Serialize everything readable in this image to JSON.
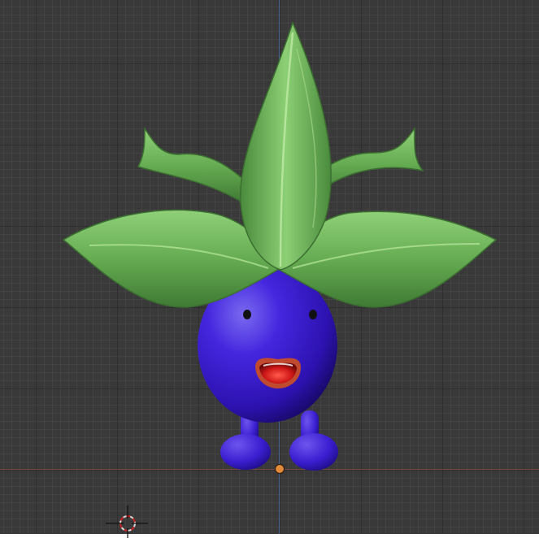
{
  "viewport": {
    "background": "#393939",
    "grid_minor_color": "#555555",
    "grid_major_color": "#1e1e1e"
  },
  "axes": {
    "x_axis_color": "#8a4a44",
    "z_axis_color": "#4e6ea8"
  },
  "object": {
    "body_color": "#3a1ed0",
    "leaf_color": "#6fb35a",
    "mouth_color": "#d01818",
    "origin_color": "#e08a3a"
  },
  "icons": [
    "3d-cursor-icon"
  ]
}
